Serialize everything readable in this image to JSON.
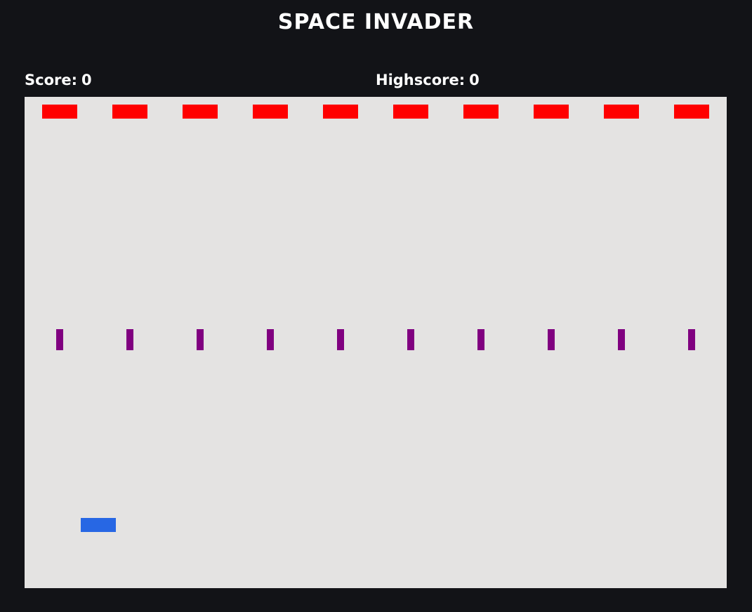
{
  "title": "SPACE INVADER",
  "hud": {
    "score_label": "Score:",
    "score": "0",
    "highscore_label": "Highscore:",
    "highscore": "0"
  },
  "game": {
    "invader_count": 10,
    "bullet_count": 10,
    "colors": {
      "page_background": "#121317",
      "board_background": "#e4e3e2",
      "invader": "#ff0000",
      "bullet": "#800080",
      "player": "#2767e4",
      "text": "#ffffff"
    }
  }
}
